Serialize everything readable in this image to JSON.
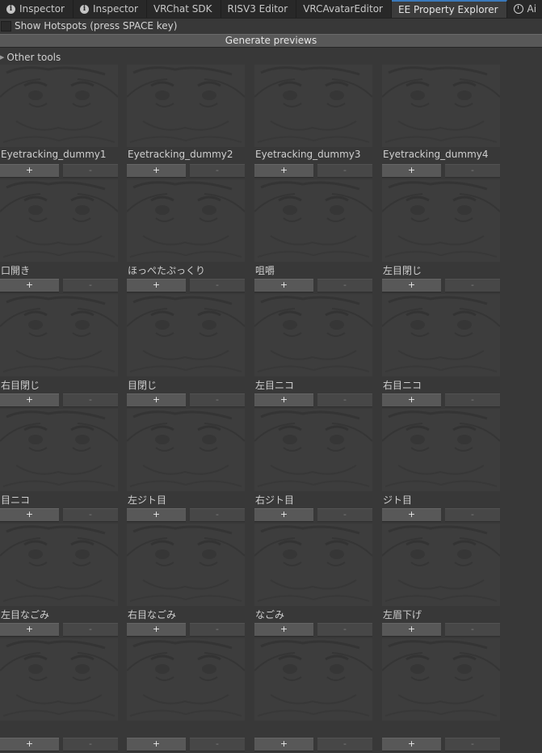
{
  "tabs": [
    {
      "label": "Inspector",
      "icon": "info-icon",
      "active": false
    },
    {
      "label": "Inspector",
      "icon": "info-icon",
      "active": false
    },
    {
      "label": "VRChat SDK",
      "icon": "",
      "active": false
    },
    {
      "label": "RISV3 Editor",
      "icon": "",
      "active": false
    },
    {
      "label": "VRCAvatarEditor",
      "icon": "",
      "active": false
    },
    {
      "label": "EE Property Explorer",
      "icon": "",
      "active": true
    },
    {
      "label": "Ai",
      "icon": "clock-icon",
      "active": false
    }
  ],
  "hotspots": {
    "label": "Show Hotspots (press SPACE key)",
    "checked": false
  },
  "generate_label": "Generate previews",
  "other_tools_label": "Other tools",
  "plus_label": "+",
  "minus_label": "-",
  "items": [
    "Eyetracking_dummy1",
    "Eyetracking_dummy2",
    "Eyetracking_dummy3",
    "Eyetracking_dummy4",
    "口開き",
    "ほっぺたぷっくり",
    "咀嚼",
    "左目閉じ",
    "右目閉じ",
    "目閉じ",
    "左目ニコ",
    "右目ニコ",
    "目ニコ",
    "左ジト目",
    "右ジト目",
    "ジト目",
    "左目なごみ",
    "右目なごみ",
    "なごみ",
    "左眉下げ",
    "",
    "",
    "",
    ""
  ],
  "colors": {
    "accent": "#3a79bb",
    "background": "#383838",
    "button": "#585858"
  }
}
